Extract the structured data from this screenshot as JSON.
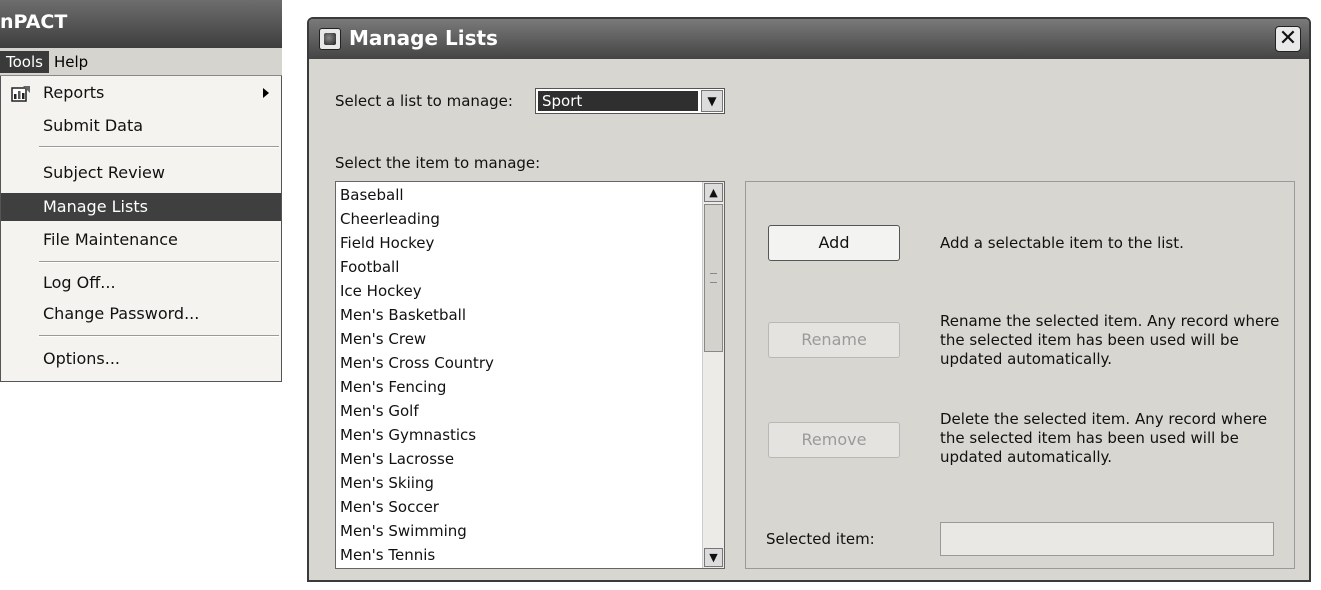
{
  "app": {
    "title": "nPACT",
    "menubar": {
      "tools": "Tools",
      "help": "Help"
    },
    "menu": {
      "reports": "Reports",
      "submit_data": "Submit Data",
      "subject_review": "Subject Review",
      "manage_lists": "Manage Lists",
      "file_maintenance": "File Maintenance",
      "log_off": "Log Off...",
      "change_password": "Change Password...",
      "options": "Options..."
    },
    "selected_menu_item": "Manage Lists",
    "icons": [
      "reports-icon",
      "submenu-arrow-icon"
    ]
  },
  "dialog": {
    "title": "Manage Lists",
    "select_list_label": "Select a list to manage:",
    "selected_list": "Sport",
    "select_item_label": "Select the item to manage:",
    "items": [
      "Baseball",
      "Cheerleading",
      "Field Hockey",
      "Football",
      "Ice Hockey",
      "Men's Basketball",
      "Men's Crew",
      "Men's Cross Country",
      "Men's Fencing",
      "Men's Golf",
      "Men's Gymnastics",
      "Men's Lacrosse",
      "Men's Skiing",
      "Men's Soccer",
      "Men's Swimming",
      "Men's Tennis"
    ],
    "add_label": "Add",
    "add_desc": "Add a selectable item to the list.",
    "rename_label": "Rename",
    "rename_desc": "Rename the selected item.  Any record where the selected item has been used will be updated automatically.",
    "remove_label": "Remove",
    "remove_desc": "Delete the selected item.  Any record where the selected item has been used will be updated automatically.",
    "selected_item_label": "Selected item:",
    "selected_item_value": "",
    "icons": [
      "app-icon",
      "close-icon",
      "dropdown-arrow-icon",
      "scroll-up-icon",
      "scroll-down-icon"
    ]
  }
}
